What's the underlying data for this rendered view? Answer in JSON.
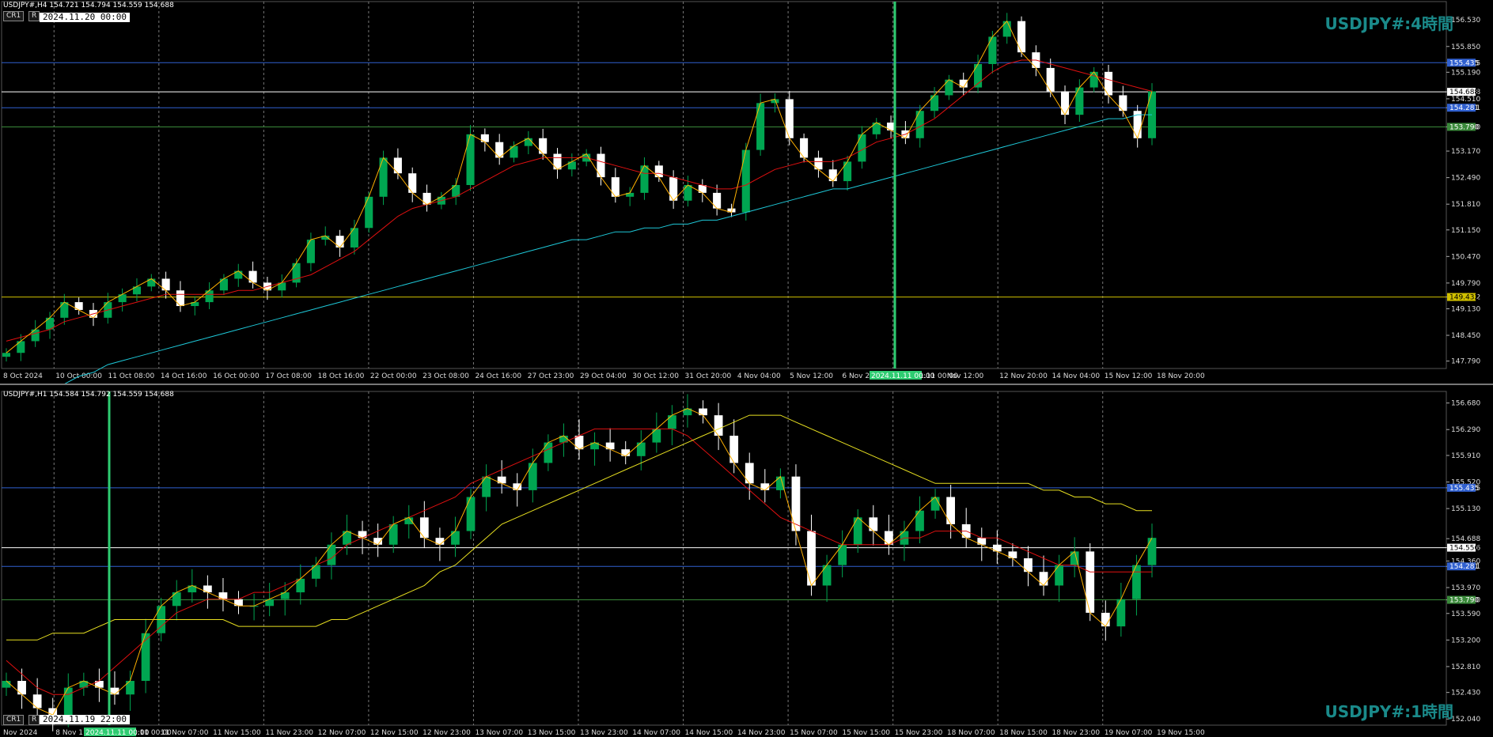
{
  "top": {
    "header": "USDJPY#,H4  154.721 154.794 154.559 154.688",
    "chip_cr": "CR1",
    "chip_r": "R",
    "date_box": "2024.11.20 00:00",
    "title": "USDJPY#:4時間",
    "cursor_date": "2024.11.11 00:00",
    "colors": {
      "up": "#00a651",
      "down": "#ffffff",
      "ma_red": "#e01010",
      "ma_cyan": "#1ec8d8",
      "zigzag": "#ffb000",
      "line_blue": "#3060d0",
      "line_green": "#3a8a3a",
      "line_yellow": "#d0c000",
      "vline": "#2ecc71"
    }
  },
  "bottom": {
    "header": "USDJPY#,H1  154.584 154.792 154.559 154.688",
    "chip_cr": "CR1",
    "chip_r": "R",
    "date_box": "2024.11.19 22:00",
    "title": "USDJPY#:1時間",
    "cursor_date": "2024.11.11 00:00"
  },
  "chart_data": [
    {
      "type": "candlestick",
      "title": "USDJPY#:4時間",
      "symbol": "USDJPY#",
      "timeframe": "H4",
      "ohlc": {
        "open": 154.721,
        "high": 154.794,
        "low": 154.559,
        "close": 154.688
      },
      "x_tick_labels": [
        "8 Oct 2024",
        "10 Oct 00:00",
        "11 Oct 08:00",
        "14 Oct 16:00",
        "16 Oct 00:00",
        "17 Oct 08:00",
        "18 Oct 16:00",
        "22 Oct 00:00",
        "23 Oct 08:00",
        "24 Oct 16:00",
        "27 Oct 23:00",
        "29 Oct 04:00",
        "30 Oct 12:00",
        "31 Oct 20:00",
        "4 Nov 04:00",
        "5 Nov 12:00",
        "6 Nov 20:00",
        "2024.11.11 00:00",
        "Nov 12:00",
        "12 Nov 20:00",
        "14 Nov 04:00",
        "15 Nov 12:00",
        "18 Nov 20:00"
      ],
      "y_tick_labels": [
        "156.530",
        "155.850",
        "155.435",
        "155.190",
        "154.688",
        "154.510",
        "154.281",
        "153.790",
        "153.170",
        "152.490",
        "151.810",
        "151.150",
        "150.470",
        "149.790",
        "149.432",
        "149.130",
        "148.450",
        "147.790"
      ],
      "ylim": [
        147.6,
        157.0
      ],
      "close_series": [
        148.0,
        148.3,
        148.6,
        148.9,
        149.3,
        149.1,
        148.9,
        149.3,
        149.5,
        149.7,
        149.9,
        149.6,
        149.2,
        149.3,
        149.6,
        149.9,
        150.1,
        149.8,
        149.6,
        149.8,
        150.3,
        150.9,
        151.0,
        150.7,
        151.2,
        152.0,
        153.0,
        152.6,
        152.1,
        151.8,
        152.0,
        152.3,
        153.6,
        153.4,
        153.0,
        153.3,
        153.5,
        153.1,
        152.7,
        152.9,
        153.1,
        152.5,
        152.0,
        152.1,
        152.8,
        152.5,
        151.9,
        152.3,
        152.1,
        151.7,
        151.6,
        153.2,
        154.4,
        154.5,
        153.5,
        153.0,
        152.7,
        152.4,
        152.9,
        153.6,
        153.9,
        153.7,
        153.5,
        154.2,
        154.6,
        155.0,
        154.8,
        155.4,
        156.1,
        156.5,
        155.7,
        155.3,
        154.7,
        154.1,
        154.8,
        155.2,
        154.6,
        154.2,
        153.5,
        154.7
      ],
      "levels": [
        {
          "value": 155.435,
          "color": "#3060d0"
        },
        {
          "value": 154.281,
          "color": "#3060d0"
        },
        {
          "value": 153.79,
          "color": "#3a8a3a"
        },
        {
          "value": 149.432,
          "color": "#d0c000"
        },
        {
          "value": 154.688,
          "color": "#ffffff"
        }
      ],
      "moving_averages": [
        {
          "color": "#e01010",
          "values": [
            148.3,
            148.4,
            148.5,
            148.6,
            148.8,
            148.9,
            149.0,
            149.1,
            149.2,
            149.3,
            149.4,
            149.5,
            149.5,
            149.5,
            149.5,
            149.5,
            149.6,
            149.6,
            149.7,
            149.8,
            149.9,
            150.0,
            150.2,
            150.4,
            150.6,
            150.9,
            151.2,
            151.5,
            151.7,
            151.8,
            151.9,
            152.0,
            152.2,
            152.4,
            152.6,
            152.8,
            152.9,
            153.0,
            153.0,
            153.0,
            153.0,
            152.9,
            152.8,
            152.7,
            152.6,
            152.6,
            152.5,
            152.4,
            152.3,
            152.2,
            152.2,
            152.3,
            152.5,
            152.7,
            152.8,
            152.9,
            152.9,
            152.9,
            153.0,
            153.2,
            153.4,
            153.5,
            153.6,
            153.8,
            154.0,
            154.3,
            154.6,
            154.9,
            155.2,
            155.4,
            155.5,
            155.5,
            155.4,
            155.3,
            155.2,
            155.1,
            155.0,
            154.9,
            154.8,
            154.7
          ]
        },
        {
          "color": "#1ec8d8",
          "values": [
            146.5,
            146.7,
            146.9,
            147.0,
            147.2,
            147.4,
            147.5,
            147.7,
            147.8,
            147.9,
            148.0,
            148.1,
            148.2,
            148.3,
            148.4,
            148.5,
            148.6,
            148.7,
            148.8,
            148.9,
            149.0,
            149.1,
            149.2,
            149.3,
            149.4,
            149.5,
            149.6,
            149.7,
            149.8,
            149.9,
            150.0,
            150.1,
            150.2,
            150.3,
            150.4,
            150.5,
            150.6,
            150.7,
            150.8,
            150.9,
            150.9,
            151.0,
            151.1,
            151.1,
            151.2,
            151.2,
            151.3,
            151.3,
            151.4,
            151.4,
            151.5,
            151.6,
            151.7,
            151.8,
            151.9,
            152.0,
            152.1,
            152.2,
            152.2,
            152.3,
            152.4,
            152.5,
            152.6,
            152.7,
            152.8,
            152.9,
            153.0,
            153.1,
            153.2,
            153.3,
            153.4,
            153.5,
            153.6,
            153.7,
            153.8,
            153.9,
            154.0,
            154.0,
            154.1,
            154.1
          ]
        }
      ]
    },
    {
      "type": "candlestick",
      "title": "USDJPY#:1時間",
      "symbol": "USDJPY#",
      "timeframe": "H1",
      "ohlc": {
        "open": 154.584,
        "high": 154.792,
        "low": 154.559,
        "close": 154.688
      },
      "x_tick_labels": [
        "Nov 2024",
        "8 Nov 1",
        "2024.11.11 00:00",
        "11 Nov 07:00",
        "11 Nov 15:00",
        "11 Nov 23:00",
        "12 Nov 07:00",
        "12 Nov 15:00",
        "12 Nov 23:00",
        "13 Nov 07:00",
        "13 Nov 15:00",
        "13 Nov 23:00",
        "14 Nov 07:00",
        "14 Nov 15:00",
        "14 Nov 23:00",
        "15 Nov 07:00",
        "15 Nov 15:00",
        "15 Nov 23:00",
        "18 Nov 07:00",
        "18 Nov 15:00",
        "18 Nov 23:00",
        "19 Nov 07:00",
        "19 Nov 15:00"
      ],
      "y_tick_labels": [
        "156.680",
        "156.290",
        "155.910",
        "155.520",
        "155.435",
        "155.130",
        "154.688",
        "154.556",
        "154.360",
        "154.281",
        "153.970",
        "153.790",
        "153.590",
        "153.200",
        "152.810",
        "152.430",
        "152.040"
      ],
      "ylim": [
        151.95,
        156.85
      ],
      "close_series": [
        152.6,
        152.4,
        152.2,
        152.1,
        152.5,
        152.6,
        152.5,
        152.4,
        152.6,
        153.3,
        153.7,
        153.9,
        154.0,
        153.9,
        153.8,
        153.7,
        153.7,
        153.8,
        153.9,
        154.1,
        154.3,
        154.6,
        154.8,
        154.7,
        154.6,
        154.9,
        155.0,
        154.7,
        154.6,
        154.8,
        155.3,
        155.6,
        155.5,
        155.4,
        155.8,
        156.1,
        156.2,
        156.0,
        156.1,
        156.0,
        155.9,
        156.1,
        156.3,
        156.5,
        156.6,
        156.5,
        156.2,
        155.8,
        155.5,
        155.4,
        155.6,
        154.8,
        154.0,
        154.3,
        154.6,
        155.0,
        154.8,
        154.6,
        154.8,
        155.1,
        155.3,
        154.9,
        154.7,
        154.6,
        154.5,
        154.4,
        154.2,
        154.0,
        154.3,
        154.5,
        153.6,
        153.4,
        153.8,
        154.3,
        154.7
      ],
      "levels": [
        {
          "value": 155.435,
          "color": "#3060d0"
        },
        {
          "value": 154.281,
          "color": "#3060d0"
        },
        {
          "value": 153.79,
          "color": "#3a8a3a"
        },
        {
          "value": 154.556,
          "color": "#ffffff"
        }
      ],
      "moving_averages": [
        {
          "color": "#e01010",
          "values": [
            152.9,
            152.7,
            152.5,
            152.4,
            152.4,
            152.5,
            152.6,
            152.8,
            153.0,
            153.2,
            153.4,
            153.6,
            153.7,
            153.8,
            153.8,
            153.8,
            153.9,
            153.9,
            154.0,
            154.1,
            154.3,
            154.4,
            154.6,
            154.7,
            154.8,
            154.9,
            155.0,
            155.1,
            155.2,
            155.3,
            155.5,
            155.6,
            155.7,
            155.8,
            155.9,
            156.0,
            156.1,
            156.2,
            156.3,
            156.3,
            156.3,
            156.3,
            156.3,
            156.3,
            156.2,
            156.0,
            155.8,
            155.6,
            155.4,
            155.2,
            155.0,
            154.9,
            154.8,
            154.7,
            154.6,
            154.6,
            154.6,
            154.6,
            154.7,
            154.7,
            154.8,
            154.8,
            154.8,
            154.7,
            154.7,
            154.6,
            154.5,
            154.4,
            154.3,
            154.3,
            154.2,
            154.2,
            154.2,
            154.2,
            154.2
          ]
        },
        {
          "color": "#e8e020",
          "values": [
            153.2,
            153.2,
            153.2,
            153.3,
            153.3,
            153.3,
            153.4,
            153.5,
            153.5,
            153.5,
            153.5,
            153.5,
            153.5,
            153.5,
            153.5,
            153.4,
            153.4,
            153.4,
            153.4,
            153.4,
            153.4,
            153.5,
            153.5,
            153.6,
            153.7,
            153.8,
            153.9,
            154.0,
            154.2,
            154.3,
            154.5,
            154.7,
            154.9,
            155.0,
            155.1,
            155.2,
            155.3,
            155.4,
            155.5,
            155.6,
            155.7,
            155.8,
            155.9,
            156.0,
            156.1,
            156.2,
            156.3,
            156.4,
            156.5,
            156.5,
            156.5,
            156.4,
            156.3,
            156.2,
            156.1,
            156.0,
            155.9,
            155.8,
            155.7,
            155.6,
            155.5,
            155.5,
            155.5,
            155.5,
            155.5,
            155.5,
            155.5,
            155.4,
            155.4,
            155.3,
            155.3,
            155.2,
            155.2,
            155.1,
            155.1
          ]
        }
      ]
    }
  ]
}
